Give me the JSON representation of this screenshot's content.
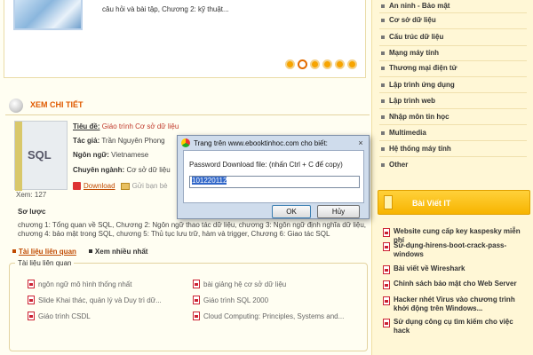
{
  "slider": {
    "text": "câu hỏi và bài tập, Chương 2: kỹ thuật...",
    "dots": 6,
    "active_dot": 2
  },
  "section": {
    "title": "XEM CHI TIẾT"
  },
  "book": {
    "cover_text": "SQL",
    "views": "Xem: 127",
    "title_label": "Tiêu đề:",
    "title_value": "Giáo trình Cơ sở dữ liệu",
    "author_label": "Tác giả:",
    "author_value": "Trần Nguyên Phong",
    "language_label": "Ngôn ngữ:",
    "language_value": "Vietnamese",
    "category_label": "Chuyên ngành:",
    "category_value": "Cơ sở dữ liệu",
    "download_label": "Download",
    "send_label": "Gửi bạn bè"
  },
  "summary": {
    "title": "Sơ lược",
    "text": "chương 1: Tổng quan về SQL, Chương 2: Ngôn ngữ thao tác dữ liệu, chương 3: Ngôn ngữ định nghĩa dữ liệu, chương 4: bảo mật trong SQL, chương 5: Thủ tục lưu trữ, hàm và trigger, Chương 6: Giao tác SQL"
  },
  "tabs": [
    {
      "label": "Tài liệu liên quan",
      "active": true
    },
    {
      "label": "Xem nhiều nhất",
      "active": false
    }
  ],
  "related": {
    "title": "Tài liệu liên quan",
    "items": [
      "ngôn ngữ mô hình thống nhất",
      "bài giảng hệ cơ sở dữ liệu",
      "Slide Khai thác, quản lý và Duy trì dữ...",
      "Giáo trình SQL 2000",
      "Giáo trình CSDL",
      "Cloud Computing: Principles, Systems and..."
    ]
  },
  "categories": [
    "An ninh - Bảo mật",
    "Cơ sở dữ liệu",
    "Cấu trúc dữ liệu",
    "Mạng máy tính",
    "Thương mại điện tử",
    "Lập trình ứng dụng",
    "Lập trình web",
    "Nhập môn tin học",
    "Multimedia",
    "Hệ thống máy tính",
    "Other"
  ],
  "articles": {
    "title": "Bài Viết IT",
    "items": [
      "Website cung cấp key kaspesky miễn phí",
      "Sử-dụng-hirens-boot-crack-pass-windows",
      "Bài viết về Wireshark",
      "Chỉnh sách bảo mật cho Web Server",
      "Hacker nhét Virus vào chương trình khởi động trên Windows...",
      "Sử dụng công cụ tìm kiếm cho việc hack"
    ]
  },
  "dialog": {
    "title": "Trang trên www.ebooktinhoc.com cho biết:",
    "label": "Password Download file: (nhấn Ctrl + C để copy)",
    "value": "101220112",
    "ok": "OK",
    "cancel": "Hủy",
    "close": "×"
  }
}
